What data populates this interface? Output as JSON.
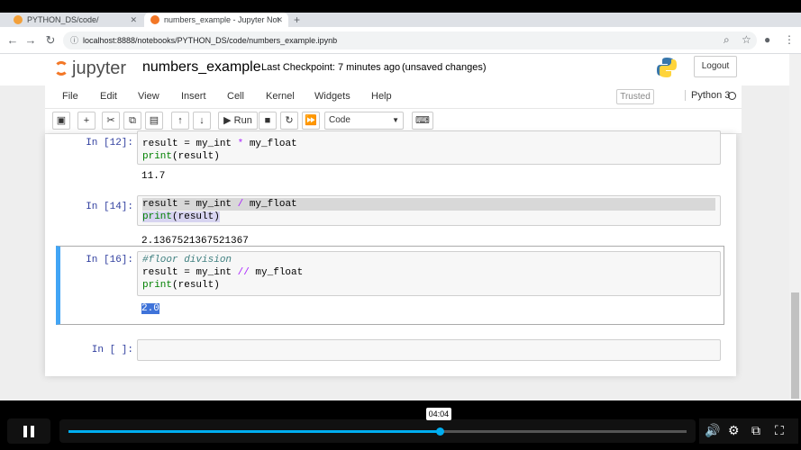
{
  "browser": {
    "tabs": [
      {
        "title": "PYTHON_DS/code/"
      },
      {
        "title": "numbers_example - Jupyter Not"
      }
    ],
    "url": "localhost:8888/notebooks/PYTHON_DS/code/numbers_example.ipynb"
  },
  "jupyter": {
    "logo_text": "jupyter",
    "notebook_name": "numbers_example",
    "checkpoint": "Last Checkpoint: 7 minutes ago",
    "unsaved": "(unsaved changes)",
    "logout": "Logout",
    "menu": [
      "File",
      "Edit",
      "View",
      "Insert",
      "Cell",
      "Kernel",
      "Widgets",
      "Help"
    ],
    "trusted": "Trusted",
    "kernel": "Python 3",
    "toolbar": {
      "run": "Run",
      "cell_type": "Code"
    }
  },
  "cells": [
    {
      "prompt": "In [12]:",
      "lines": [
        "result = my_int * my_float",
        "print(result)"
      ],
      "output": "11.7"
    },
    {
      "prompt": "In [14]:",
      "lines": [
        "result = my_int / my_float",
        "print(result)"
      ],
      "output": "2.1367521367521367"
    },
    {
      "prompt": "In [16]:",
      "lines": [
        "#floor division",
        "result = my_int // my_float",
        "print(result)"
      ],
      "output": "2.0"
    },
    {
      "prompt": "In [ ]:",
      "lines": [],
      "output": ""
    }
  ],
  "video": {
    "time": "04:04",
    "progress": 0.6
  }
}
